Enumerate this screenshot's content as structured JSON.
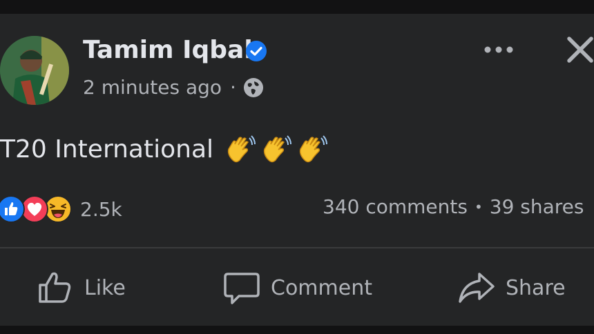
{
  "post": {
    "author": "Tamim Iqbal",
    "timestamp": "2 minutes ago",
    "separator": "·",
    "text": "T20 International",
    "emoji": [
      "waving-hand",
      "waving-hand",
      "waving-hand"
    ]
  },
  "reactions": {
    "types": [
      "like",
      "love",
      "haha"
    ],
    "count": "2.5k"
  },
  "stats": {
    "comments": "340 comments",
    "bullet": "•",
    "shares": "39 shares"
  },
  "actions": {
    "like": "Like",
    "comment": "Comment",
    "share": "Share"
  },
  "colors": {
    "background": "#242526",
    "text_primary": "#e4e6eb",
    "text_secondary": "#b0b3b8",
    "verified_blue": "#1877f2",
    "like_blue": "#1877f2",
    "love_red": "#f33e58",
    "haha_yellow": "#f7b928"
  },
  "icons": {
    "verified": "verified-badge-icon",
    "audience": "globe-icon",
    "more": "more-options-icon",
    "close": "close-icon",
    "like_action": "thumbs-up-icon",
    "comment_action": "comment-bubble-icon",
    "share_action": "share-arrow-icon"
  }
}
